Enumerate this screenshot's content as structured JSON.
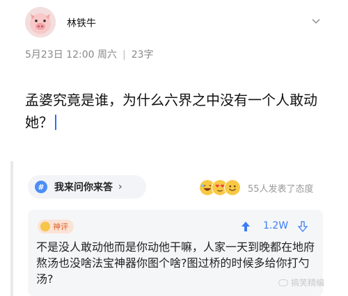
{
  "header": {
    "username": "林铁牛",
    "avatar_icon": "pig-avatar",
    "menu_icon": "chevron-down-icon"
  },
  "meta": {
    "date": "5月23日 12:00 周六",
    "separator": "|",
    "word_count": "23字"
  },
  "question": {
    "text": "孟婆究竟是谁，为什么六界之中没有一个人敢动她？"
  },
  "answer_prompt": {
    "icon": "#",
    "label": "我来问你来答",
    "chevron": "›"
  },
  "reactions": {
    "summary": "55人发表了态度",
    "emojis": [
      "laughing-emoji",
      "heart-eyes-emoji",
      "smile-emoji"
    ]
  },
  "top_answer": {
    "badge": "神评",
    "likes": "1.2W",
    "text": "不是没人敢动他而是你动他干嘛，人家一天到晚都在地府熬汤也没啥法宝神器你图个啥?图过桥的时候多给你打勺汤?"
  },
  "watermark": {
    "text": "搞笑精编"
  },
  "colors": {
    "accent": "#3b7cf6",
    "badge_text": "#e0622f",
    "badge_bg": "#fbe3d6",
    "muted": "#888888"
  }
}
